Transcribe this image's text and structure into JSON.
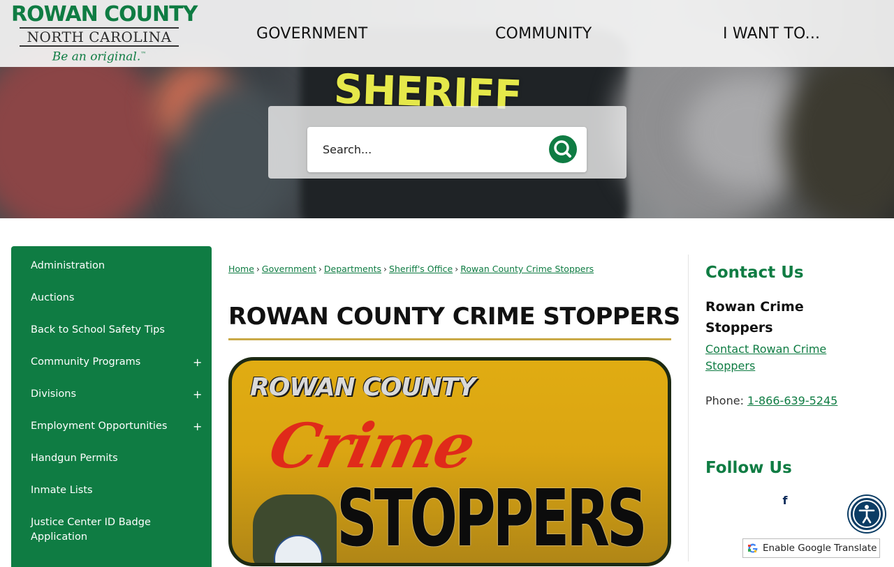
{
  "header": {
    "logo": {
      "name": "ROWAN COUNTY",
      "state": "NORTH CAROLINA",
      "tagline": "Be an original.",
      "trademark": "™"
    },
    "nav": [
      {
        "label": "GOVERNMENT"
      },
      {
        "label": "COMMUNITY"
      },
      {
        "label": "I WANT TO..."
      }
    ]
  },
  "hero": {
    "patch_text": "SHERIFF"
  },
  "search": {
    "placeholder": "Search...",
    "button_icon": "search-icon"
  },
  "sidebar": {
    "items": [
      {
        "label": "Administration",
        "expandable": false
      },
      {
        "label": "Auctions",
        "expandable": false
      },
      {
        "label": "Back to School Safety Tips",
        "expandable": false
      },
      {
        "label": "Community Programs",
        "expandable": true
      },
      {
        "label": "Divisions",
        "expandable": true
      },
      {
        "label": "Employment Opportunities",
        "expandable": true
      },
      {
        "label": "Handgun Permits",
        "expandable": false
      },
      {
        "label": "Inmate Lists",
        "expandable": false
      },
      {
        "label": "Justice Center ID Badge Application",
        "expandable": false
      }
    ],
    "expand_symbol": "+"
  },
  "breadcrumb": {
    "items": [
      "Home",
      "Government",
      "Departments",
      "Sheriff's Office",
      "Rowan County Crime Stoppers"
    ],
    "separator": "›"
  },
  "main": {
    "title": "ROWAN COUNTY CRIME STOPPERS",
    "banner": {
      "top_text": "ROWAN COUNTY",
      "crime_text": "Crime",
      "stoppers_text": "STOPPERS"
    }
  },
  "contact": {
    "heading": "Contact Us",
    "name": "Rowan Crime Stoppers",
    "link_label": "Contact Rowan Crime Stoppers",
    "phone_label": "Phone: ",
    "phone_value": "1-866-639-5245"
  },
  "follow": {
    "heading": "Follow Us",
    "facebook_label": "f"
  },
  "translate": {
    "label": "Enable Google Translate"
  },
  "colors": {
    "brand_green": "#0f7c43",
    "gold_rule": "#c9a947",
    "a11y_blue": "#0b3c64"
  }
}
